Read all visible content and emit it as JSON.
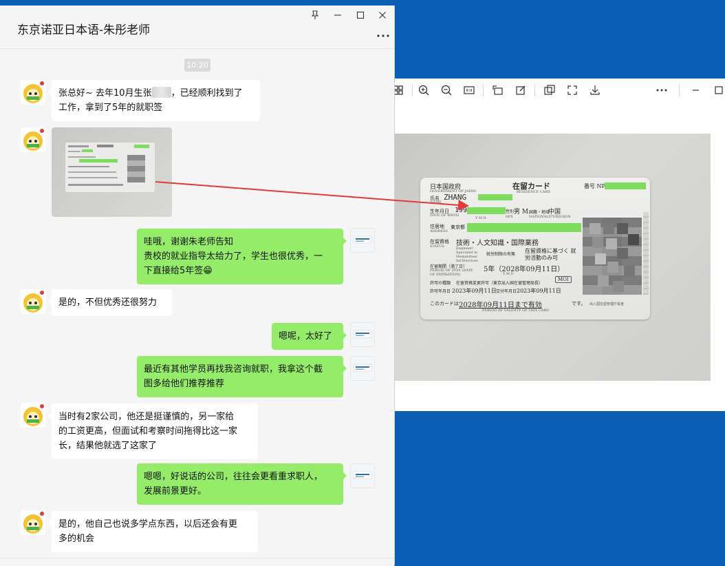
{
  "chat": {
    "title": "东京诺亚日本语-朱彤老师",
    "time": "10:20",
    "messages": [
      {
        "side": "left",
        "lines": [
          "张总好~ 去年10月生张",
          "，已经顺利找到了",
          "工作，拿到了5年的就职签"
        ]
      },
      {
        "side": "right",
        "lines": [
          "哇哦，谢谢朱老师告知",
          "贵校的就业指导太给力了，学生也很优秀，一",
          "下直接给5年签😁"
        ]
      },
      {
        "side": "left",
        "lines": [
          "是的，不但优秀还很努力"
        ]
      },
      {
        "side": "right",
        "lines": [
          "嗯呢，太好了"
        ]
      },
      {
        "side": "right",
        "lines": [
          "最近有其他学员再找我咨询就职，我拿这个截",
          "图多给他们推荐推荐"
        ]
      },
      {
        "side": "left",
        "lines": [
          "当时有2家公司，他还是挺谨慎的，另一家给",
          "的工资更高，但面试和考察时间拖得比这一家",
          "长，结果他就选了这家了"
        ]
      },
      {
        "side": "right",
        "lines": [
          "嗯嗯，好说话的公司，往往会更看重求职人，",
          "发展前景更好。"
        ]
      },
      {
        "side": "left",
        "lines": [
          "是的，他自己也说多学点东西，以后还会有更",
          "多的机会"
        ]
      }
    ]
  },
  "card": {
    "header_jp": "日本国政府",
    "header_en": "GOVERNMENT OF JAPAN",
    "title_jp": "在留カード",
    "title_en": "RESIDENCE CARD",
    "number_label": "番号 NP",
    "name_label": "氏名",
    "name_label_en": "NAME",
    "name_value": "ZHANG",
    "dob_label": "生年月日",
    "dob_label_en": "DATE OF BIRTH",
    "dob_value": "199",
    "ymd": "Y   M   D",
    "sex_label": "性別",
    "sex_label_en": "SEX",
    "sex_value": "男 M.",
    "nationality_label": "国籍・地域",
    "nationality_label_en": "NATIONALITY/REGION",
    "nationality_value": "中国",
    "address_label": "住居地",
    "address_label_en": "ADDRESS",
    "address_value": "東京都",
    "status_label": "在留資格",
    "status_label_en": "STATUS",
    "status_value": "技術・人文知識・国際業務",
    "status_value_en": "Engineer/ Specialist in Humanities/ Int'lServices",
    "work_label": "就労制限の有無",
    "work_value": "在留資格に基づく 就労活動のみ可",
    "period_label": "在留期間（満了日）",
    "period_label_en": "PERIOD OF STAY (DATE OF EXPIRATION)",
    "period_value": "5年（2028年09月11日）",
    "permit_label": "許可の種類",
    "permit_value": "在留資格変更許可（東京出入国在留管理局長）",
    "permit_date_label": "許可年月日",
    "permit_date": "2023年09月11日",
    "issue_date_label": "交付年月日",
    "issue_date": "2023年09月11日",
    "validity_prefix": "このカードは",
    "validity_value": "2028年09月11日まで有効",
    "validity_suffix": "です。",
    "validity_en": "PERIOD OF VALIDITY OF THIS CARD",
    "mof": "MOI",
    "issuer": "出入国在留管理庁長官"
  },
  "colors": {
    "bubble_green": "#95ec69",
    "desktop_blue": "#0a5fb4",
    "arrow_red": "#e53935",
    "redact_green": "#7ddc5c"
  },
  "icons": {
    "pin": "pin-icon",
    "minimize": "minimize-icon",
    "maximize": "maximize-icon",
    "close": "close-icon",
    "more": "more-icon"
  }
}
